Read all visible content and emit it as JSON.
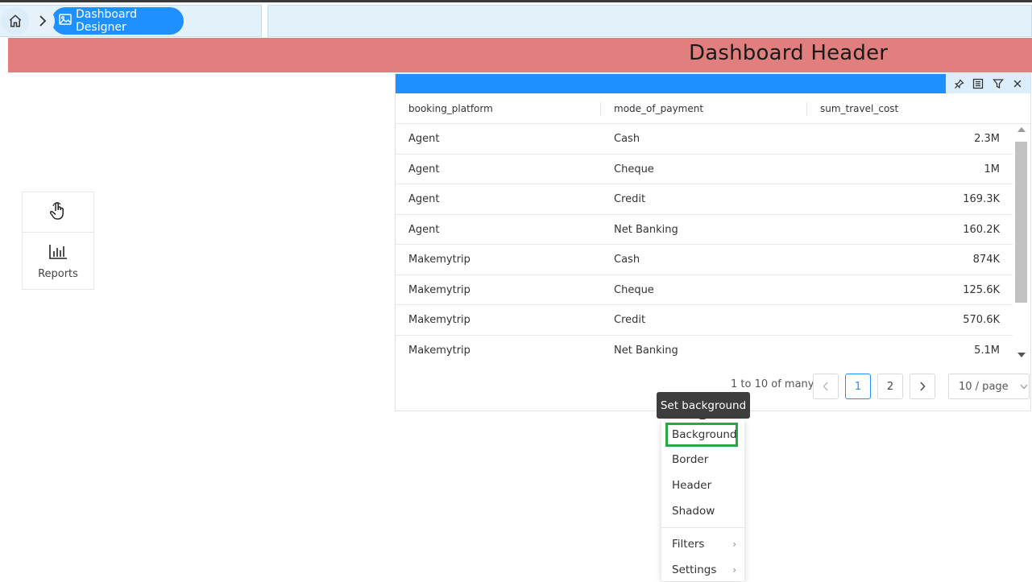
{
  "breadcrumb": {
    "home_icon": "home-icon",
    "chevron_icon": "chevron-right-icon",
    "current_icon": "image-icon",
    "current_label": "Dashboard Designer"
  },
  "dashboard": {
    "header_title": "Dashboard Header"
  },
  "tools": {
    "interact_icon": "hand-pointer-icon",
    "reports_icon": "bar-chart-icon",
    "reports_label": "Reports"
  },
  "widget": {
    "bar_color": "#1e90ff",
    "tool_icons": [
      "pin-icon",
      "table-view-icon",
      "filter-icon",
      "close-icon"
    ],
    "columns": [
      "booking_platform",
      "mode_of_payment",
      "sum_travel_cost"
    ],
    "rows": [
      [
        "Agent",
        "Cash",
        "2.3M"
      ],
      [
        "Agent",
        "Cheque",
        "1M"
      ],
      [
        "Agent",
        "Credit",
        "169.3K"
      ],
      [
        "Agent",
        "Net Banking",
        "160.2K"
      ],
      [
        "Makemytrip",
        "Cash",
        "874K"
      ],
      [
        "Makemytrip",
        "Cheque",
        "125.6K"
      ],
      [
        "Makemytrip",
        "Credit",
        "570.6K"
      ],
      [
        "Makemytrip",
        "Net Banking",
        "5.1M"
      ]
    ],
    "pagination": {
      "summary": "1 to 10 of many",
      "pages": [
        "1",
        "2"
      ],
      "active_page": "1",
      "page_size": "10 / page"
    }
  },
  "tooltip": {
    "text": "Set background"
  },
  "context_menu": {
    "items": [
      "Background",
      "Border",
      "Header",
      "Shadow"
    ],
    "submenus": [
      "Filters",
      "Settings"
    ],
    "highlight_color": "#27a844"
  }
}
